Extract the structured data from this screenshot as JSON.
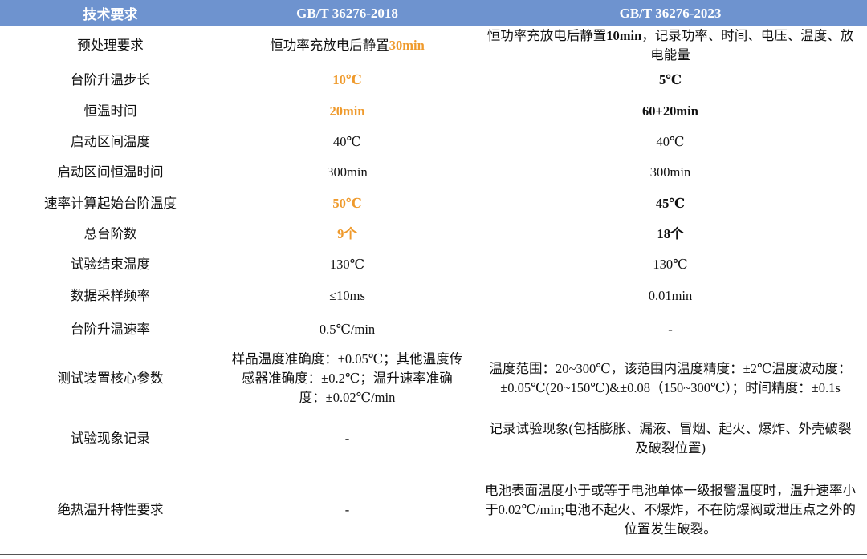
{
  "header": {
    "col1": "技术要求",
    "col2": "GB/T 36276-2018",
    "col3": "GB/T 36276-2023"
  },
  "rows": [
    {
      "req": "预处理要求",
      "old_prefix": "恒功率充放电后静置",
      "old_hl": "30min",
      "new_prefix": "恒功率充放电后静置",
      "new_bold": "10min",
      "new_suffix": "，记录功率、时间、电压、温度、放电能量"
    },
    {
      "req": "台阶升温步长",
      "old": "10℃",
      "new": "5℃"
    },
    {
      "req": "恒温时间",
      "old": "20min",
      "new": "60+20min"
    },
    {
      "req": "启动区间温度",
      "old": "40℃",
      "new": "40℃"
    },
    {
      "req": "启动区间恒温时间",
      "old": "300min",
      "new": "300min"
    },
    {
      "req": "速率计算起始台阶温度",
      "old": "50℃",
      "new": "45℃"
    },
    {
      "req": "总台阶数",
      "old": "9个",
      "new": "18个"
    },
    {
      "req": "试验结束温度",
      "old": "130℃",
      "new": "130℃"
    },
    {
      "req": "数据采样频率",
      "old": "≤10ms",
      "new": "0.01min"
    },
    {
      "req": "台阶升温速率",
      "old": "0.5℃/min",
      "new": "-"
    },
    {
      "req": "测试装置核心参数",
      "old": "样品温度准确度：±0.05℃；其他温度传感器准确度：±0.2℃；温升速率准确度：±0.02℃/min",
      "new": "温度范围：20~300℃，该范围内温度精度：±2℃温度波动度：±0.05℃(20~150℃)&±0.08（150~300℃）；时间精度：±0.1s"
    },
    {
      "req": "试验现象记录",
      "old": "-",
      "new": "记录试验现象(包括膨胀、漏液、冒烟、起火、爆炸、外壳破裂及破裂位置)"
    },
    {
      "req": "绝热温升特性要求",
      "old": "-",
      "new": "电池表面温度小于或等于电池单体一级报警温度时，温升速率小于0.02℃/min;电池不起火、不爆炸，不在防爆阀或泄压点之外的位置发生破裂。"
    }
  ]
}
